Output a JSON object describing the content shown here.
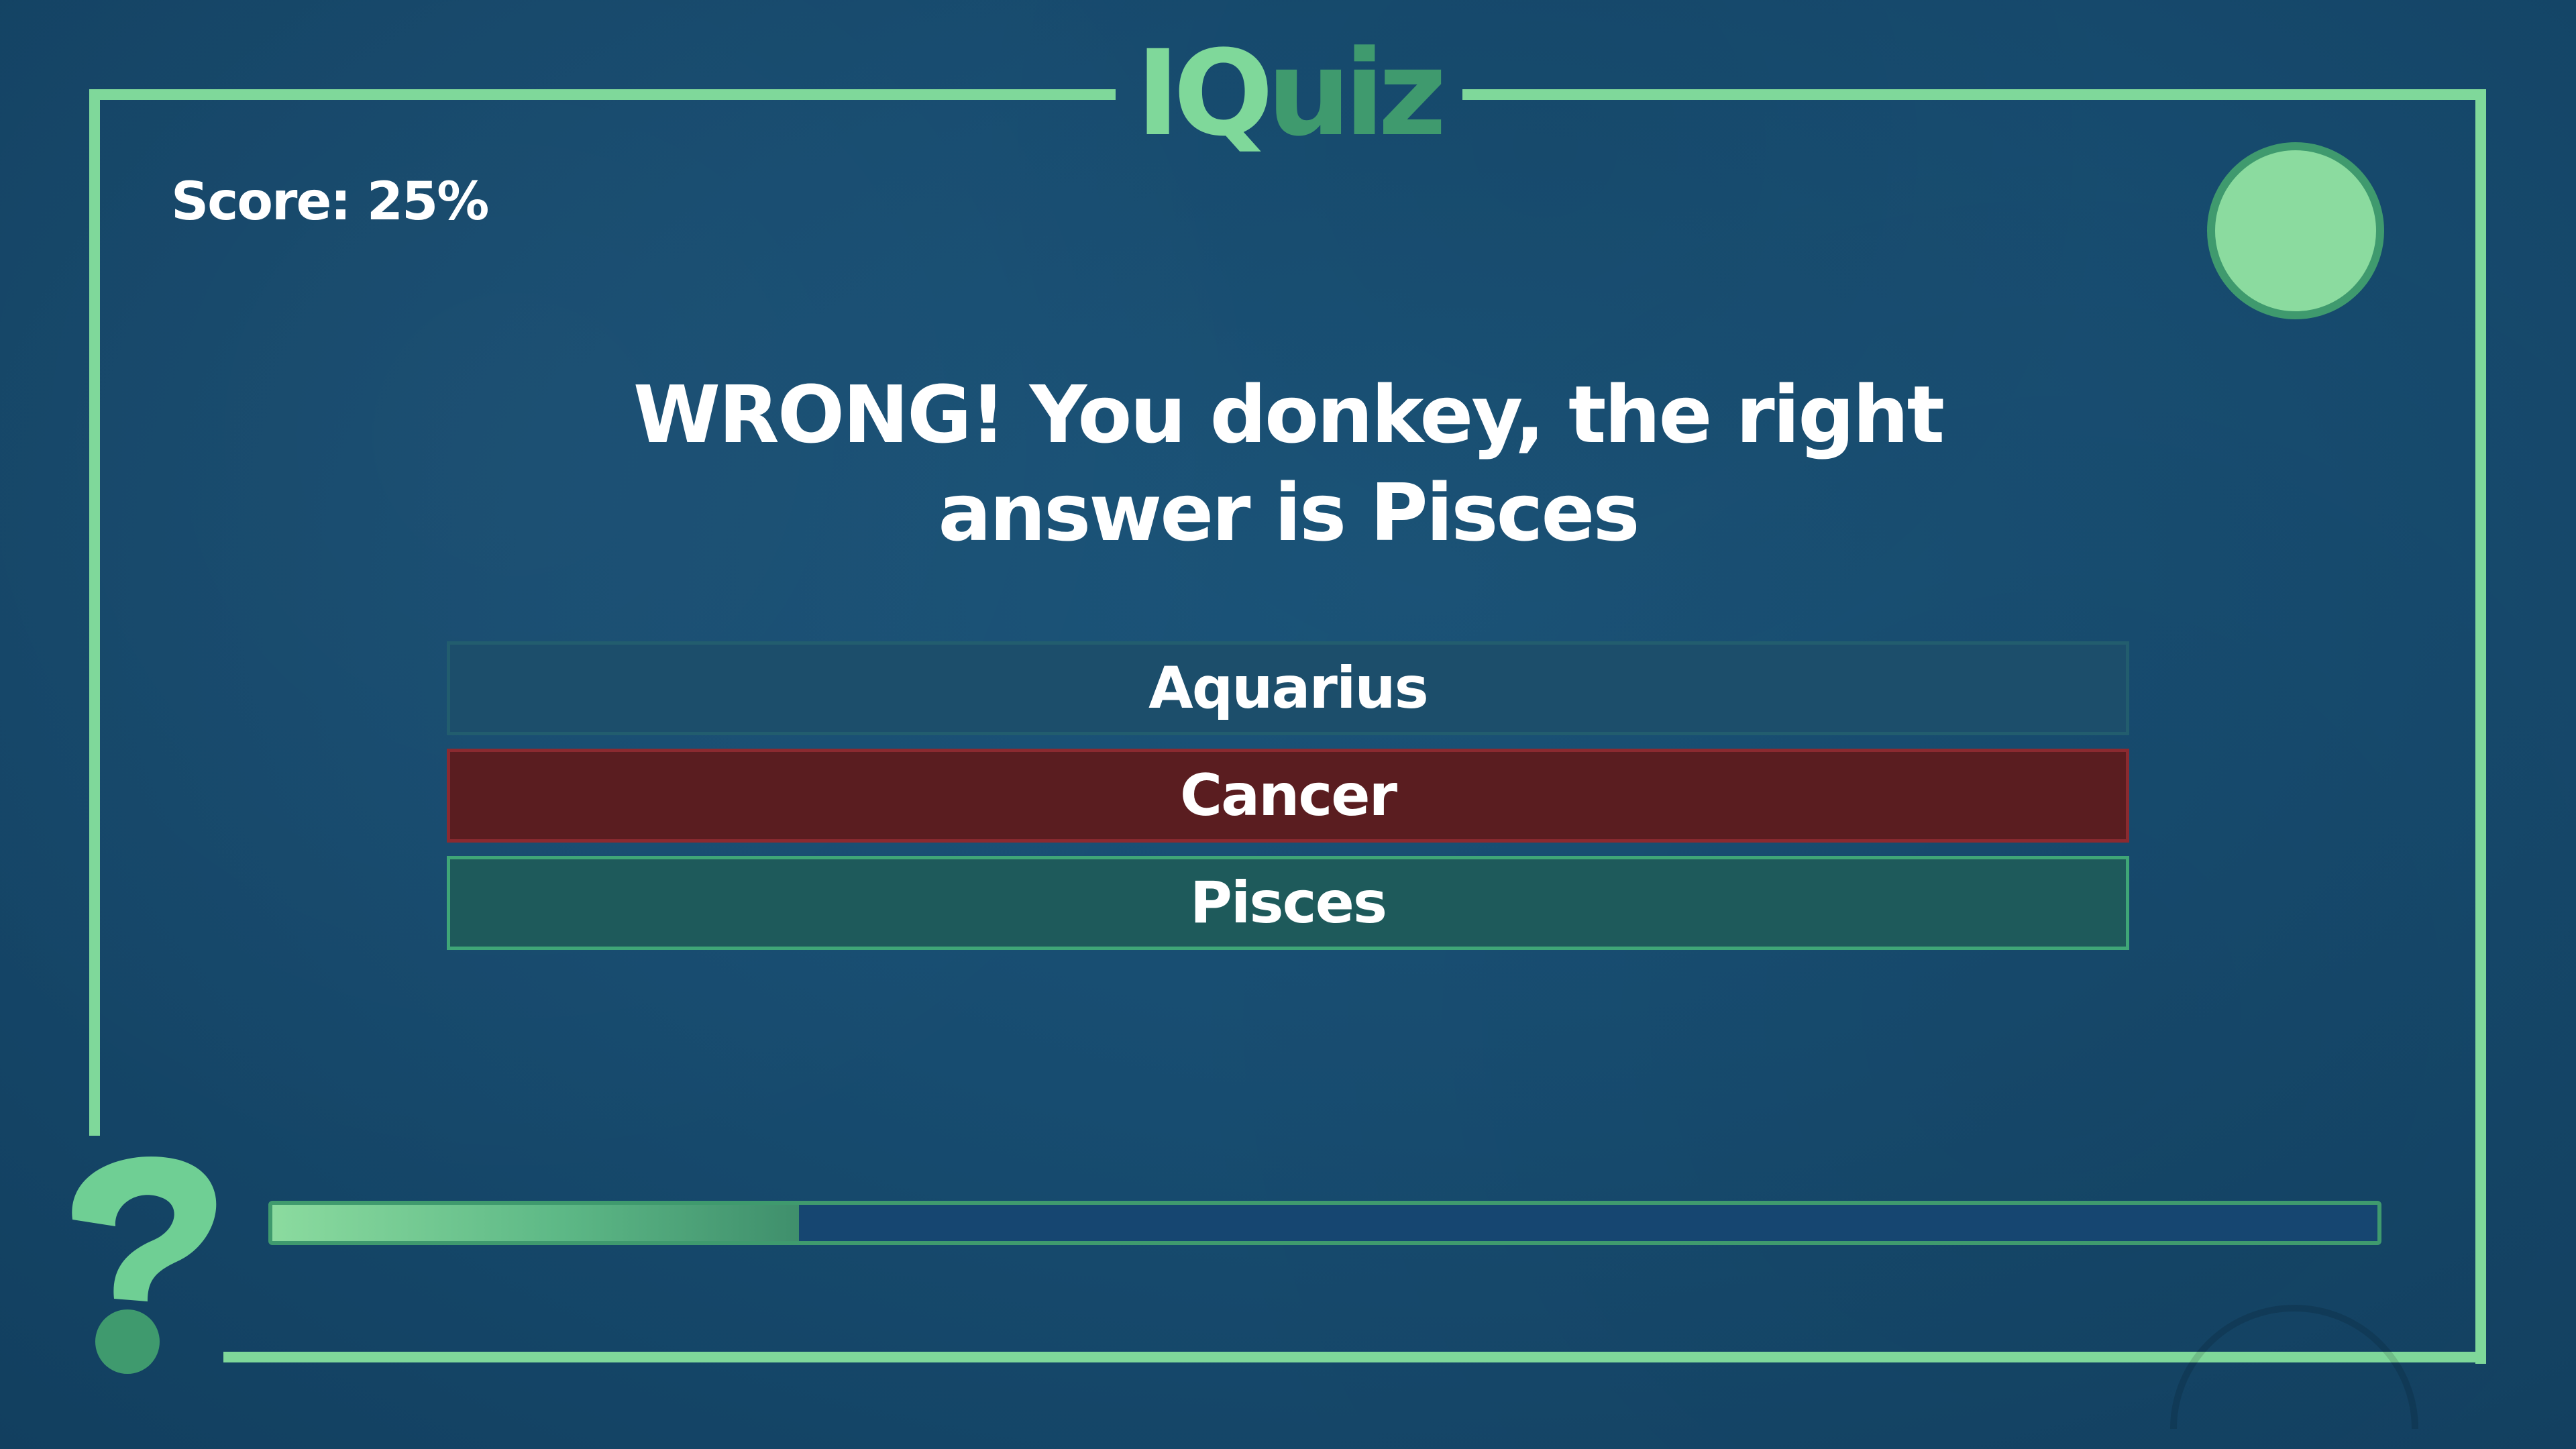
{
  "logo": {
    "part1": "IQ",
    "part2": "uiz"
  },
  "score_text": "Score: 25%",
  "message": "WRONG! You donkey, the right answer is Pisces",
  "answers": [
    {
      "label": "Aquarius",
      "state": "neutral"
    },
    {
      "label": "Cancer",
      "state": "wrong"
    },
    {
      "label": "Pisces",
      "state": "correct"
    }
  ],
  "progress": {
    "value": 0.25
  },
  "colors": {
    "accent": "#7fd89a",
    "accent_dark": "#3f9a6e",
    "background": "#174c70",
    "wrong": "#5a1d20",
    "correct": "#1e5a5b"
  },
  "icons": {
    "corner": "question-mark-icon",
    "timer": "timer-circle-icon"
  }
}
